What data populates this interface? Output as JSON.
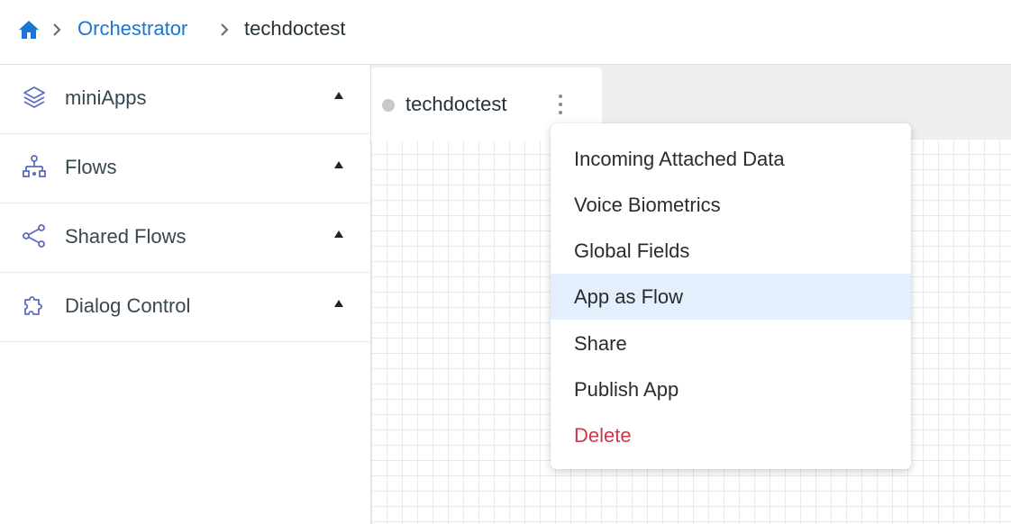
{
  "breadcrumb": {
    "home_icon": "home-icon",
    "items": [
      {
        "label": "Orchestrator"
      },
      {
        "label": "techdoctest"
      }
    ]
  },
  "sidebar": {
    "items": [
      {
        "label": "miniApps",
        "icon": "layers-icon"
      },
      {
        "label": "Flows",
        "icon": "flow-tree-icon"
      },
      {
        "label": "Shared Flows",
        "icon": "share-icon"
      },
      {
        "label": "Dialog Control",
        "icon": "puzzle-icon"
      }
    ]
  },
  "canvas": {
    "tab_title": "techdoctest",
    "status_dot_color": "#c8c8c8"
  },
  "context_menu": {
    "items": [
      {
        "label": "Incoming Attached Data"
      },
      {
        "label": "Voice Biometrics"
      },
      {
        "label": "Global Fields"
      },
      {
        "label": "App as Flow",
        "highlighted": true
      },
      {
        "label": "Share"
      },
      {
        "label": "Publish App"
      },
      {
        "label": "Delete",
        "danger": true
      }
    ]
  },
  "colors": {
    "link": "#1976d2",
    "icon": "#5c6bc0",
    "highlight": "#e3effd",
    "danger": "#d1344b"
  }
}
